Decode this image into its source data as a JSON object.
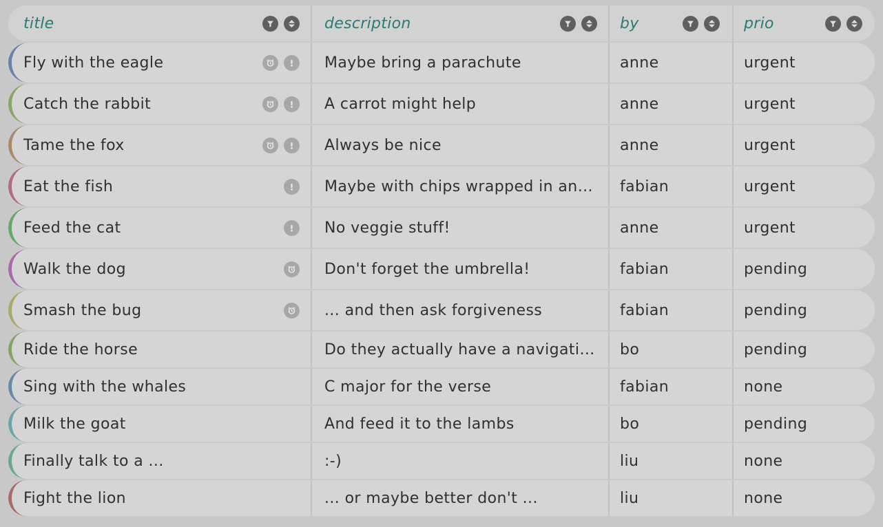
{
  "columns": [
    {
      "key": "title",
      "label": "title"
    },
    {
      "key": "description",
      "label": "description"
    },
    {
      "key": "by",
      "label": "by"
    },
    {
      "key": "prio",
      "label": "prio"
    }
  ],
  "rows": [
    {
      "title": "Fly with the eagle",
      "description": "Maybe bring a parachute",
      "by": "anne",
      "prio": "urgent",
      "icons": [
        "alarm-icon",
        "alert-icon"
      ],
      "color": "#6a84a8"
    },
    {
      "title": "Catch the rabbit",
      "description": "A carrot might help",
      "by": "anne",
      "prio": "urgent",
      "icons": [
        "alarm-icon",
        "alert-icon"
      ],
      "color": "#8aa56a"
    },
    {
      "title": "Tame the fox",
      "description": "Always be nice",
      "by": "anne",
      "prio": "urgent",
      "icons": [
        "alarm-icon",
        "alert-icon"
      ],
      "color": "#a88a6a"
    },
    {
      "title": "Eat the fish",
      "description": "Maybe with chips wrapped in an o...",
      "by": "fabian",
      "prio": "urgent",
      "icons": [
        "alert-icon"
      ],
      "color": "#b06a8a"
    },
    {
      "title": "Feed the cat",
      "description": "No veggie stuff!",
      "by": "anne",
      "prio": "urgent",
      "icons": [
        "alert-icon"
      ],
      "color": "#6aa56a"
    },
    {
      "title": "Walk the dog",
      "description": "Don't forget the umbrella!",
      "by": "fabian",
      "prio": "pending",
      "icons": [
        "alarm-icon"
      ],
      "color": "#a86aa8"
    },
    {
      "title": "Smash the bug",
      "description": "... and then ask forgiveness",
      "by": "fabian",
      "prio": "pending",
      "icons": [
        "alarm-icon"
      ],
      "color": "#a8a86a"
    },
    {
      "title": "Ride the horse",
      "description": "Do they actually have a navigation...",
      "by": "bo",
      "prio": "pending",
      "icons": [],
      "color": "#88a06a"
    },
    {
      "title": "Sing with the whales",
      "description": "C major for the verse",
      "by": "fabian",
      "prio": "none",
      "icons": [],
      "color": "#6a88a8"
    },
    {
      "title": "Milk the goat",
      "description": "And feed it to the lambs",
      "by": "bo",
      "prio": "pending",
      "icons": [],
      "color": "#6aa5a8"
    },
    {
      "title": "Finally talk to a ...",
      "description": ":-)",
      "by": "liu",
      "prio": "none",
      "icons": [],
      "color": "#6aa88a"
    },
    {
      "title": "Fight the lion",
      "description": "... or maybe better don't ...",
      "by": "liu",
      "prio": "none",
      "icons": [],
      "color": "#a86a6a"
    }
  ]
}
